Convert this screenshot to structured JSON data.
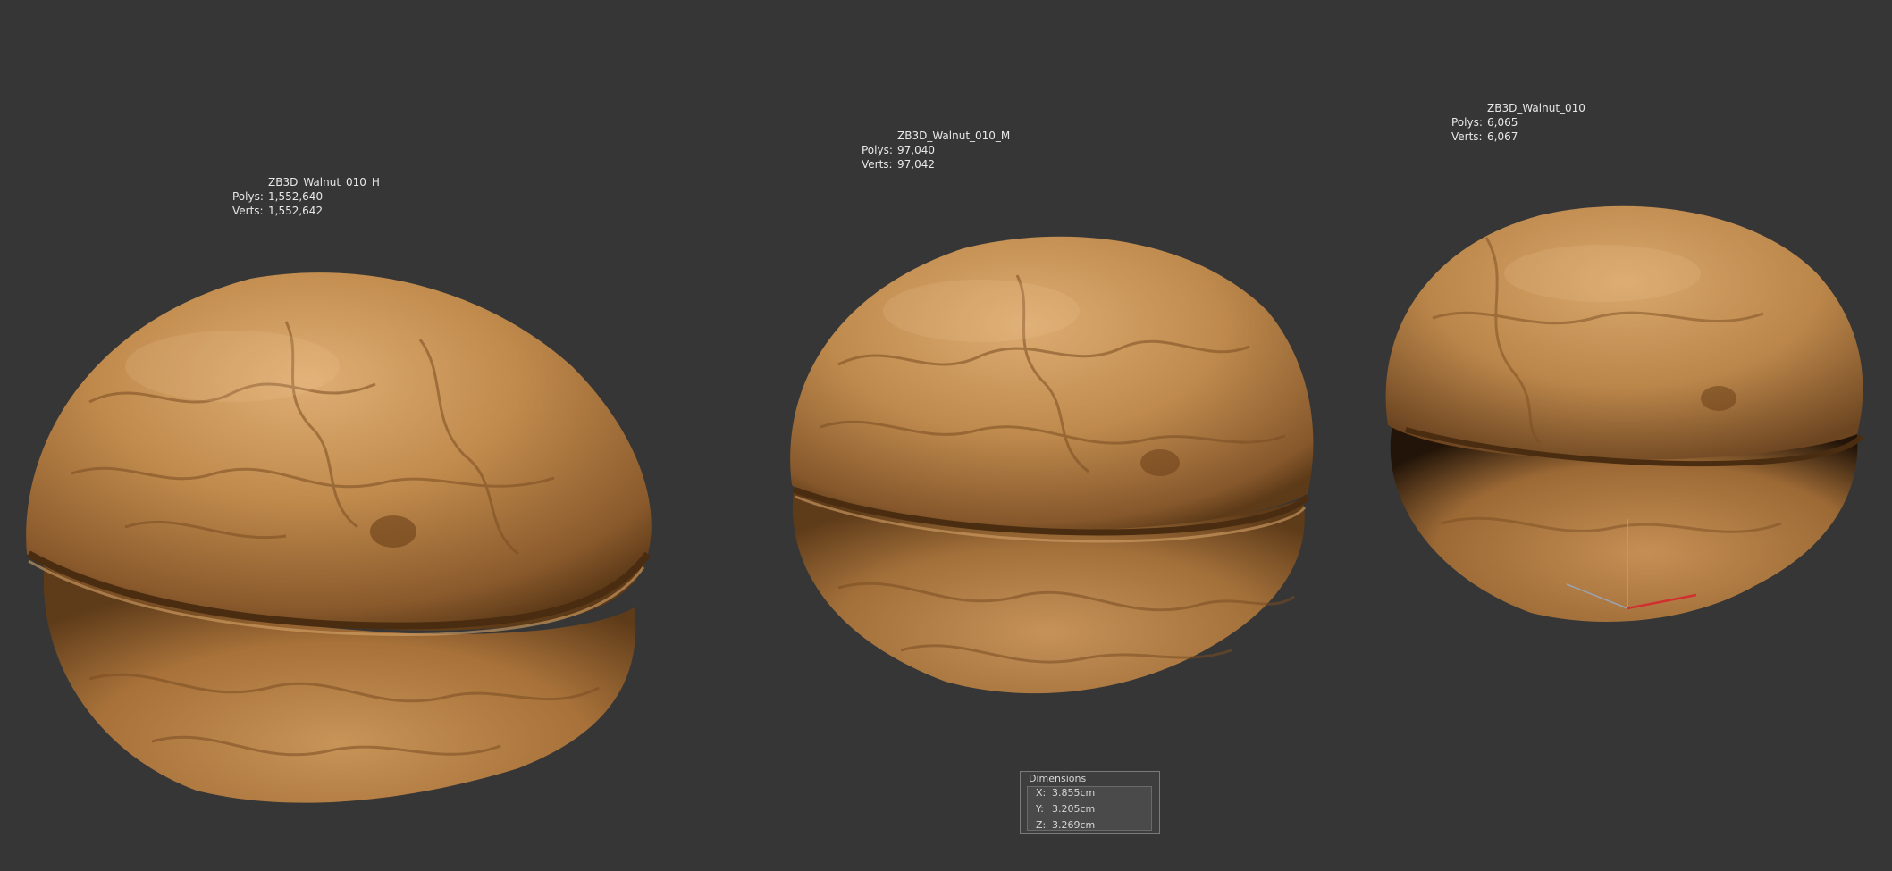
{
  "models": [
    {
      "name": "ZB3D_Walnut_010_H",
      "polys_label": "Polys:",
      "polys": "1,552,640",
      "verts_label": "Verts:",
      "verts": "1,552,642"
    },
    {
      "name": "ZB3D_Walnut_010_M",
      "polys_label": "Polys:",
      "polys": "97,040",
      "verts_label": "Verts:",
      "verts": "97,042"
    },
    {
      "name": "ZB3D_Walnut_010",
      "polys_label": "Polys:",
      "polys": "6,065",
      "verts_label": "Verts:",
      "verts": "6,067"
    }
  ],
  "dimensions": {
    "title": "Dimensions",
    "x_label": "X:",
    "x": "3.855cm",
    "y_label": "Y:",
    "y": "3.205cm",
    "z_label": "Z:",
    "z": "3.269cm"
  },
  "colors": {
    "background": "#363636",
    "shell_light": "#d9a76a",
    "shell_mid": "#b57f43",
    "shell_dark": "#6e4520",
    "text": "#e8e8e8"
  }
}
